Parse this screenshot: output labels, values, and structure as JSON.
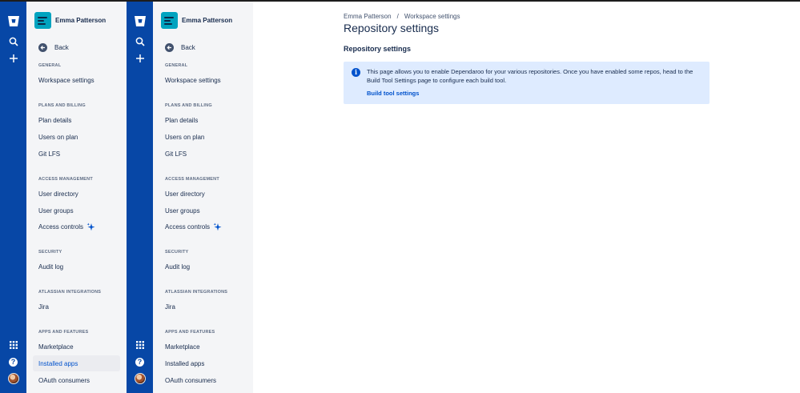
{
  "workspace": {
    "name": "Emma Patterson"
  },
  "sidebar": {
    "back_label": "Back",
    "sections": [
      {
        "title": "GENERAL",
        "items": [
          "Workspace settings"
        ]
      },
      {
        "title": "PLANS AND BILLING",
        "items": [
          "Plan details",
          "Users on plan",
          "Git LFS"
        ]
      },
      {
        "title": "ACCESS MANAGEMENT",
        "items": [
          "User directory",
          "User groups",
          "Access controls"
        ]
      },
      {
        "title": "SECURITY",
        "items": [
          "Audit log"
        ]
      },
      {
        "title": "ATLASSIAN INTEGRATIONS",
        "items": [
          "Jira"
        ]
      },
      {
        "title": "APPS AND FEATURES",
        "items": [
          "Marketplace",
          "Installed apps",
          "OAuth consumers"
        ]
      }
    ],
    "selected_item_panel1": "Installed apps"
  },
  "breadcrumb": {
    "items": [
      "Emma Patterson",
      "Workspace settings"
    ],
    "separator": "/"
  },
  "main": {
    "title": "Repository settings",
    "section_title": "Repository settings",
    "info": {
      "text": "This page allows you to enable Dependaroo for your various repositories. Once you have enabled some repos, head to the Build Tool Settings page to configure each build tool.",
      "link_label": "Build tool settings"
    }
  },
  "colors": {
    "rail": "#0747a6",
    "sidebar_bg": "#f4f5f7",
    "accent": "#0052cc",
    "info_bg": "#deebff",
    "workspace_avatar": "#00a3bf"
  },
  "icons": [
    "bitbucket-logo-icon",
    "search-icon",
    "plus-icon",
    "app-switcher-icon",
    "help-icon",
    "profile-avatar",
    "back-arrow-icon",
    "sparkle-icon",
    "info-icon"
  ]
}
